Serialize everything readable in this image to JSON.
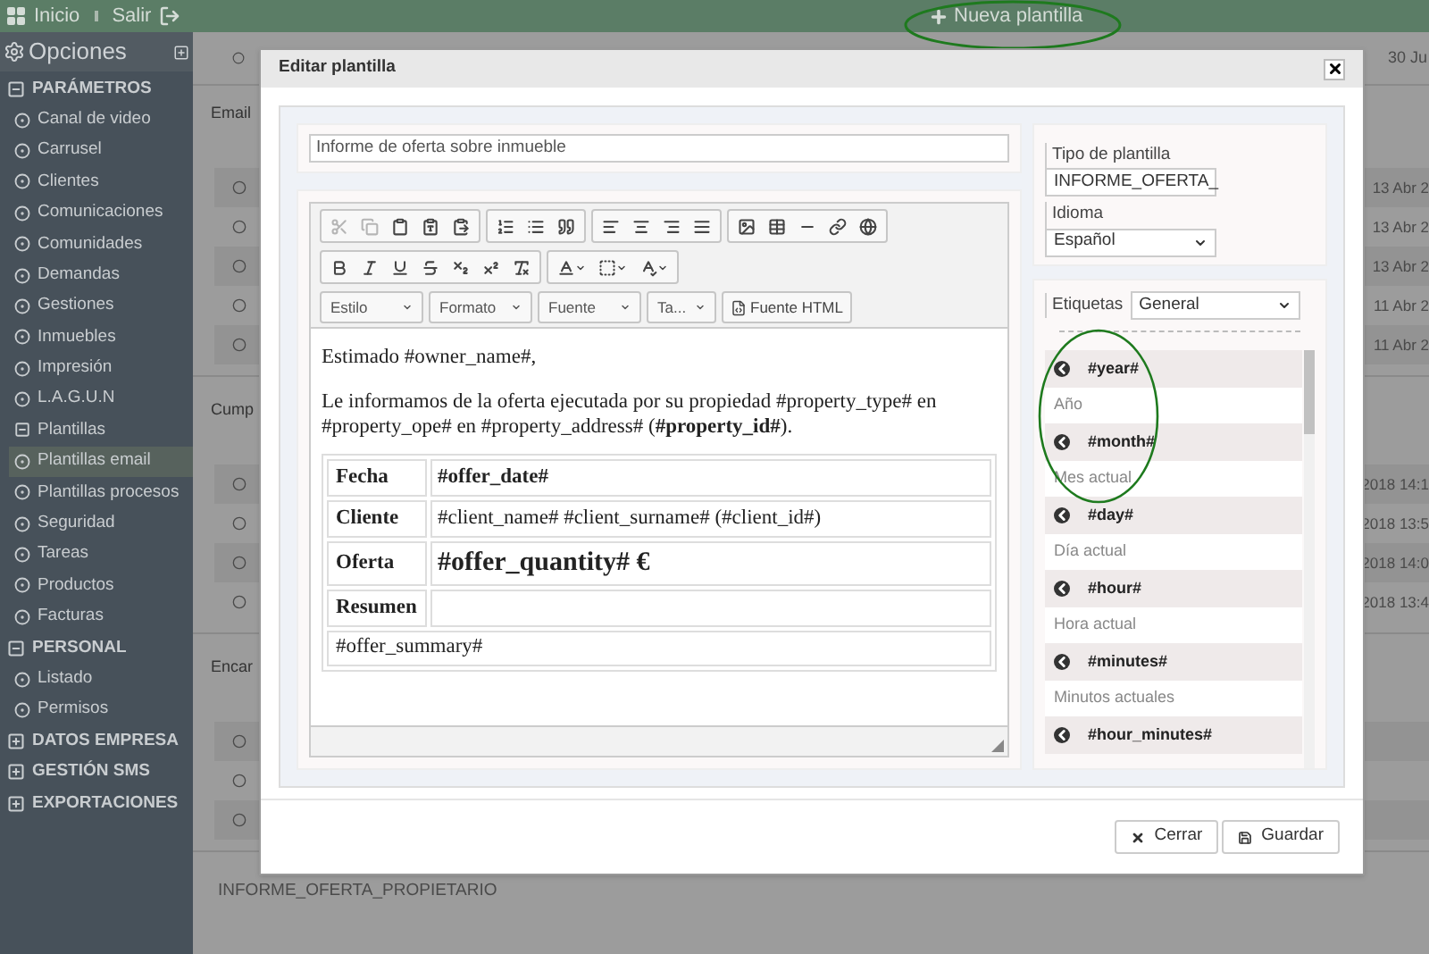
{
  "topbar": {
    "home": "Inicio",
    "logout": "Salir",
    "new_button": "Nueva plantilla"
  },
  "sidebar": {
    "title": "Opciones",
    "items": [
      {
        "label": "PARÁMETROS",
        "kind": "section",
        "expanded": true,
        "children": [
          {
            "label": "Canal de video",
            "selected": false
          },
          {
            "label": "Carrusel",
            "selected": false
          },
          {
            "label": "Clientes",
            "selected": false
          },
          {
            "label": "Comunicaciones",
            "selected": false
          },
          {
            "label": "Comunidades",
            "selected": false
          },
          {
            "label": "Demandas",
            "selected": false
          },
          {
            "label": "Gestiones",
            "selected": false
          },
          {
            "label": "Inmuebles",
            "selected": false
          },
          {
            "label": "Impresión",
            "selected": false
          },
          {
            "label": "L.A.G.U.N",
            "selected": false
          },
          {
            "label": "Plantillas",
            "kind": "group",
            "expanded": true,
            "children": [
              {
                "label": "Plantillas email",
                "selected": true
              },
              {
                "label": "Plantillas procesos",
                "selected": false
              }
            ]
          },
          {
            "label": "Seguridad",
            "selected": false
          },
          {
            "label": "Tareas",
            "selected": false
          },
          {
            "label": "Productos",
            "selected": false
          },
          {
            "label": "Facturas",
            "selected": false
          }
        ]
      },
      {
        "label": "PERSONAL",
        "kind": "section",
        "expanded": true,
        "children": [
          {
            "label": "Listado",
            "selected": false
          },
          {
            "label": "Permisos",
            "selected": false
          }
        ]
      },
      {
        "label": "DATOS EMPRESA",
        "kind": "section",
        "expanded": false
      },
      {
        "label": "GESTIÓN SMS",
        "kind": "section",
        "expanded": false
      },
      {
        "label": "EXPORTACIONES",
        "kind": "section",
        "expanded": false
      }
    ]
  },
  "background": {
    "top_date": "30 Ju",
    "sections": [
      {
        "title": "Email",
        "rows": [
          "13 Abr 2",
          "13 Abr 2",
          "13 Abr 2",
          "11 Abr 2",
          "11 Abr 2"
        ]
      },
      {
        "title": "Cump",
        "rows": [
          "2018 14:1",
          "2018 13:5",
          "2018 14:0",
          "2018 13:4"
        ]
      },
      {
        "title": "Encar",
        "rows": [
          "",
          "",
          ""
        ]
      }
    ],
    "bottom_section": "INFORME_OFERTA_PROPIETARIO"
  },
  "modal": {
    "title": "Editar plantilla",
    "name_field": "Informe de oferta sobre inmueble",
    "toolbar_groups": [
      [
        {
          "kind": "cut",
          "disabled": true
        },
        {
          "kind": "copy",
          "disabled": true
        },
        {
          "kind": "paste",
          "disabled": false
        },
        {
          "kind": "paste-text",
          "disabled": false
        },
        {
          "kind": "paste-word",
          "disabled": false
        }
      ],
      [
        {
          "kind": "ordered-list",
          "disabled": false
        },
        {
          "kind": "bullet-list",
          "disabled": false
        },
        {
          "kind": "quote",
          "disabled": false
        }
      ],
      [
        {
          "kind": "align-left",
          "disabled": false
        },
        {
          "kind": "align-center",
          "disabled": false
        },
        {
          "kind": "align-right",
          "disabled": false
        },
        {
          "kind": "align-justify",
          "disabled": false
        }
      ],
      [
        {
          "kind": "image",
          "disabled": false
        },
        {
          "kind": "table",
          "disabled": false
        },
        {
          "kind": "rule",
          "disabled": false
        },
        {
          "kind": "link",
          "disabled": false
        },
        {
          "kind": "globe",
          "disabled": false
        }
      ],
      [
        {
          "kind": "bold",
          "disabled": false
        },
        {
          "kind": "italic",
          "disabled": false
        },
        {
          "kind": "underline",
          "disabled": false
        },
        {
          "kind": "strike",
          "disabled": false
        },
        {
          "kind": "subscript",
          "disabled": false
        },
        {
          "kind": "superscript",
          "disabled": false
        },
        {
          "kind": "clear-format",
          "disabled": false
        }
      ],
      [
        {
          "kind": "text-color",
          "disabled": false
        },
        {
          "kind": "bg-color",
          "disabled": false
        },
        {
          "kind": "spellcheck",
          "disabled": false
        }
      ]
    ],
    "dropdowns": [
      "Estilo",
      "Formato",
      "Fuente",
      "Ta..."
    ],
    "source_button": "Fuente HTML",
    "content": {
      "greeting": "Estimado #owner_name#,",
      "paragraph": "Le informamos de la oferta ejecutada por su propiedad #property_type# en #property_ope# en #property_address# (**#property_id#**).",
      "table": [
        {
          "kind": "bold",
          "label": "Fecha",
          "value": "#offer_date#"
        },
        {
          "kind": "plain",
          "label": "Cliente",
          "value": "#client_name# #client_surname# (#client_id#)"
        },
        {
          "kind": "large",
          "label": "Oferta",
          "value": "#offer_quantity# €"
        },
        {
          "kind": "plain",
          "label": "Resumen"
        },
        {
          "kind": "full",
          "value": "#offer_summary#"
        }
      ]
    },
    "type_label": "Tipo de plantilla",
    "type_value": "INFORME_OFERTA_",
    "language_label": "Idioma",
    "language_value": "Español",
    "tags_label": "Etiquetas",
    "tags_filter": "General",
    "tags": [
      {
        "tag": "#year#",
        "description": "Año"
      },
      {
        "tag": "#month#",
        "description": "Mes actual"
      },
      {
        "tag": "#day#",
        "description": "Día actual"
      },
      {
        "tag": "#hour#",
        "description": "Hora actual"
      },
      {
        "tag": "#minutes#",
        "description": "Minutos actuales"
      },
      {
        "tag": "#hour_minutes#"
      }
    ],
    "buttons": [
      {
        "kind": "close",
        "label": "Cerrar"
      },
      {
        "kind": "save",
        "label": "Guardar"
      }
    ]
  }
}
